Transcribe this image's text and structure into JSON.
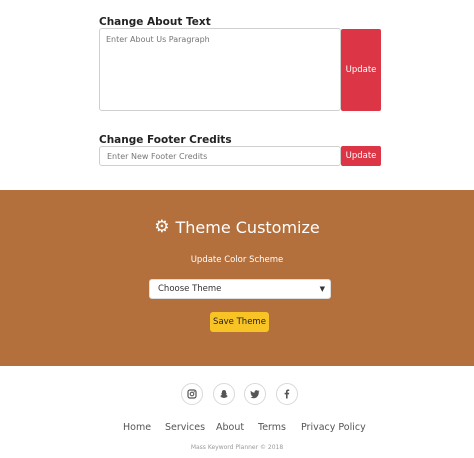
{
  "about": {
    "label": "Change About Text",
    "placeholder": "Enter About Us Paragraph",
    "button": "Update"
  },
  "footer_credits": {
    "label": "Change Footer Credits",
    "placeholder": "Enter New Footer Credits",
    "button": "Update"
  },
  "theme": {
    "title": "Theme Customize",
    "subtitle": "Update Color Scheme",
    "select_value": "Choose Theme",
    "save_button": "Save Theme",
    "background_color": "#b3703d",
    "accent_red": "#dc3545",
    "accent_yellow": "#f7c325"
  },
  "social": [
    {
      "icon": "instagram-icon"
    },
    {
      "icon": "snapchat-icon"
    },
    {
      "icon": "twitter-icon"
    },
    {
      "icon": "facebook-icon"
    }
  ],
  "nav": [
    "Home",
    "Services",
    "About",
    "Terms",
    "Privacy Policy"
  ],
  "copyright": "Mass Keyword Planner © 2018"
}
